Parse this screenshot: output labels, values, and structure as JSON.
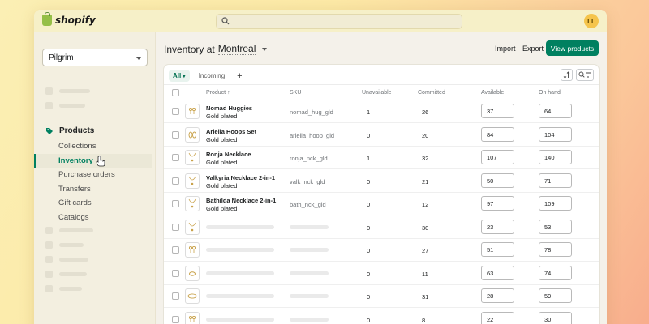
{
  "app": {
    "brand": "shopify",
    "user_initials": "LL"
  },
  "sidebar": {
    "store": "Pilgrim",
    "products_label": "Products",
    "sub_items": [
      "Collections",
      "Inventory",
      "Purchase orders",
      "Transfers",
      "Gift cards",
      "Catalogs"
    ],
    "active_item": "Inventory"
  },
  "main": {
    "heading_prefix": "Inventory at",
    "location": "Montreal",
    "import_label": "Import",
    "export_label": "Export",
    "view_products_label": "View products"
  },
  "table": {
    "tabs": {
      "all": "All",
      "incoming": "Incoming",
      "add": "+"
    },
    "columns": {
      "product": "Product",
      "sku": "SKU",
      "unavailable": "Unavailable",
      "committed": "Committed",
      "available": "Available",
      "on_hand": "On hand"
    },
    "rows": [
      {
        "name": "Nomad Huggies",
        "variant": "Gold plated",
        "sku": "nomad_hug_gld",
        "unavailable": "1",
        "committed": "26",
        "available": "37",
        "on_hand": "64",
        "thumb": "earring-icon"
      },
      {
        "name": "Ariella Hoops Set",
        "variant": "Gold plated",
        "sku": "ariella_hoop_gld",
        "unavailable": "0",
        "committed": "20",
        "available": "84",
        "on_hand": "104",
        "thumb": "hoops-icon"
      },
      {
        "name": "Ronja Necklace",
        "variant": "Gold plated",
        "sku": "ronja_nck_gld",
        "unavailable": "1",
        "committed": "32",
        "available": "107",
        "on_hand": "140",
        "thumb": "necklace-icon"
      },
      {
        "name": "Valkyria Necklace 2-in-1",
        "variant": "Gold plated",
        "sku": "valk_nck_gld",
        "unavailable": "0",
        "committed": "21",
        "available": "50",
        "on_hand": "71",
        "thumb": "necklace-icon"
      },
      {
        "name": "Bathilda Necklace 2-in-1",
        "variant": "Gold plated",
        "sku": "bath_nck_gld",
        "unavailable": "0",
        "committed": "12",
        "available": "97",
        "on_hand": "109",
        "thumb": "necklace-icon"
      },
      {
        "name": "",
        "variant": "",
        "sku": "",
        "unavailable": "0",
        "committed": "30",
        "available": "23",
        "on_hand": "53",
        "thumb": "necklace-icon"
      },
      {
        "name": "",
        "variant": "",
        "sku": "",
        "unavailable": "0",
        "committed": "27",
        "available": "51",
        "on_hand": "78",
        "thumb": "earring-icon"
      },
      {
        "name": "",
        "variant": "",
        "sku": "",
        "unavailable": "0",
        "committed": "11",
        "available": "63",
        "on_hand": "74",
        "thumb": "ring-icon"
      },
      {
        "name": "",
        "variant": "",
        "sku": "",
        "unavailable": "0",
        "committed": "31",
        "available": "28",
        "on_hand": "59",
        "thumb": "bracelet-icon"
      },
      {
        "name": "",
        "variant": "",
        "sku": "",
        "unavailable": "0",
        "committed": "8",
        "available": "22",
        "on_hand": "30",
        "thumb": "earring-icon"
      }
    ]
  },
  "colors": {
    "accent": "#008060",
    "avatar": "#f5c44c",
    "gold": "#c9a24a"
  }
}
